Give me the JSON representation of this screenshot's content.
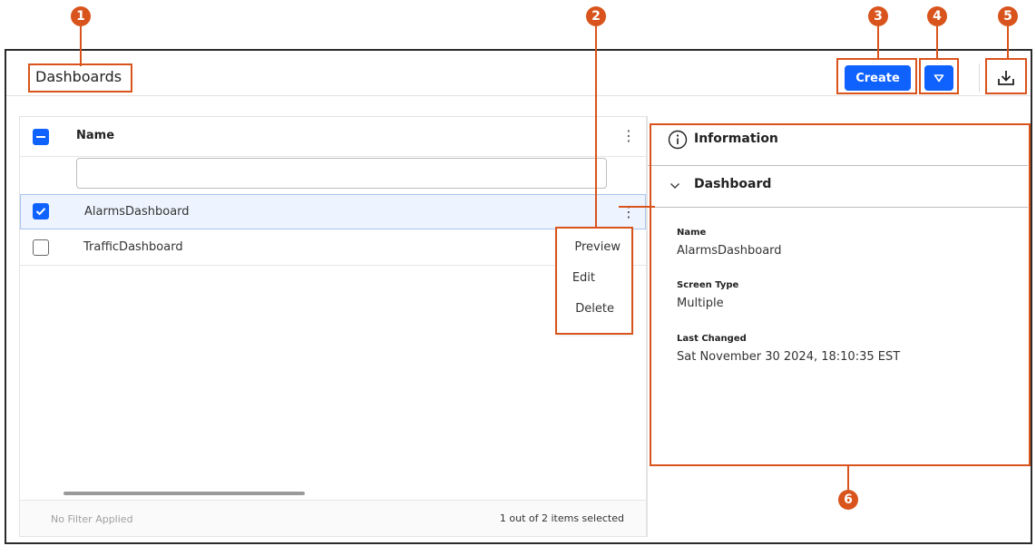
{
  "callouts": [
    "1",
    "2",
    "3",
    "4",
    "5",
    "6"
  ],
  "header": {
    "title": "Dashboards",
    "create_label": "Create"
  },
  "table": {
    "column_name": "Name",
    "filter_value": "",
    "rows": [
      {
        "name": "AlarmsDashboard",
        "checked": true
      },
      {
        "name": "TrafficDashboard",
        "checked": false
      }
    ],
    "footer_left": "No Filter Applied",
    "footer_right": "1 out of 2 items selected"
  },
  "context_menu": {
    "items": [
      "Preview",
      "Edit",
      "Delete"
    ]
  },
  "info": {
    "title": "Information",
    "section": "Dashboard",
    "fields": [
      {
        "label": "Name",
        "value": "AlarmsDashboard"
      },
      {
        "label": "Screen Type",
        "value": "Multiple"
      },
      {
        "label": "Last Changed",
        "value": "Sat November 30 2024, 18:10:35 EST"
      }
    ]
  },
  "colors": {
    "accent": "#0f62fe",
    "callout": "#d9541c"
  }
}
